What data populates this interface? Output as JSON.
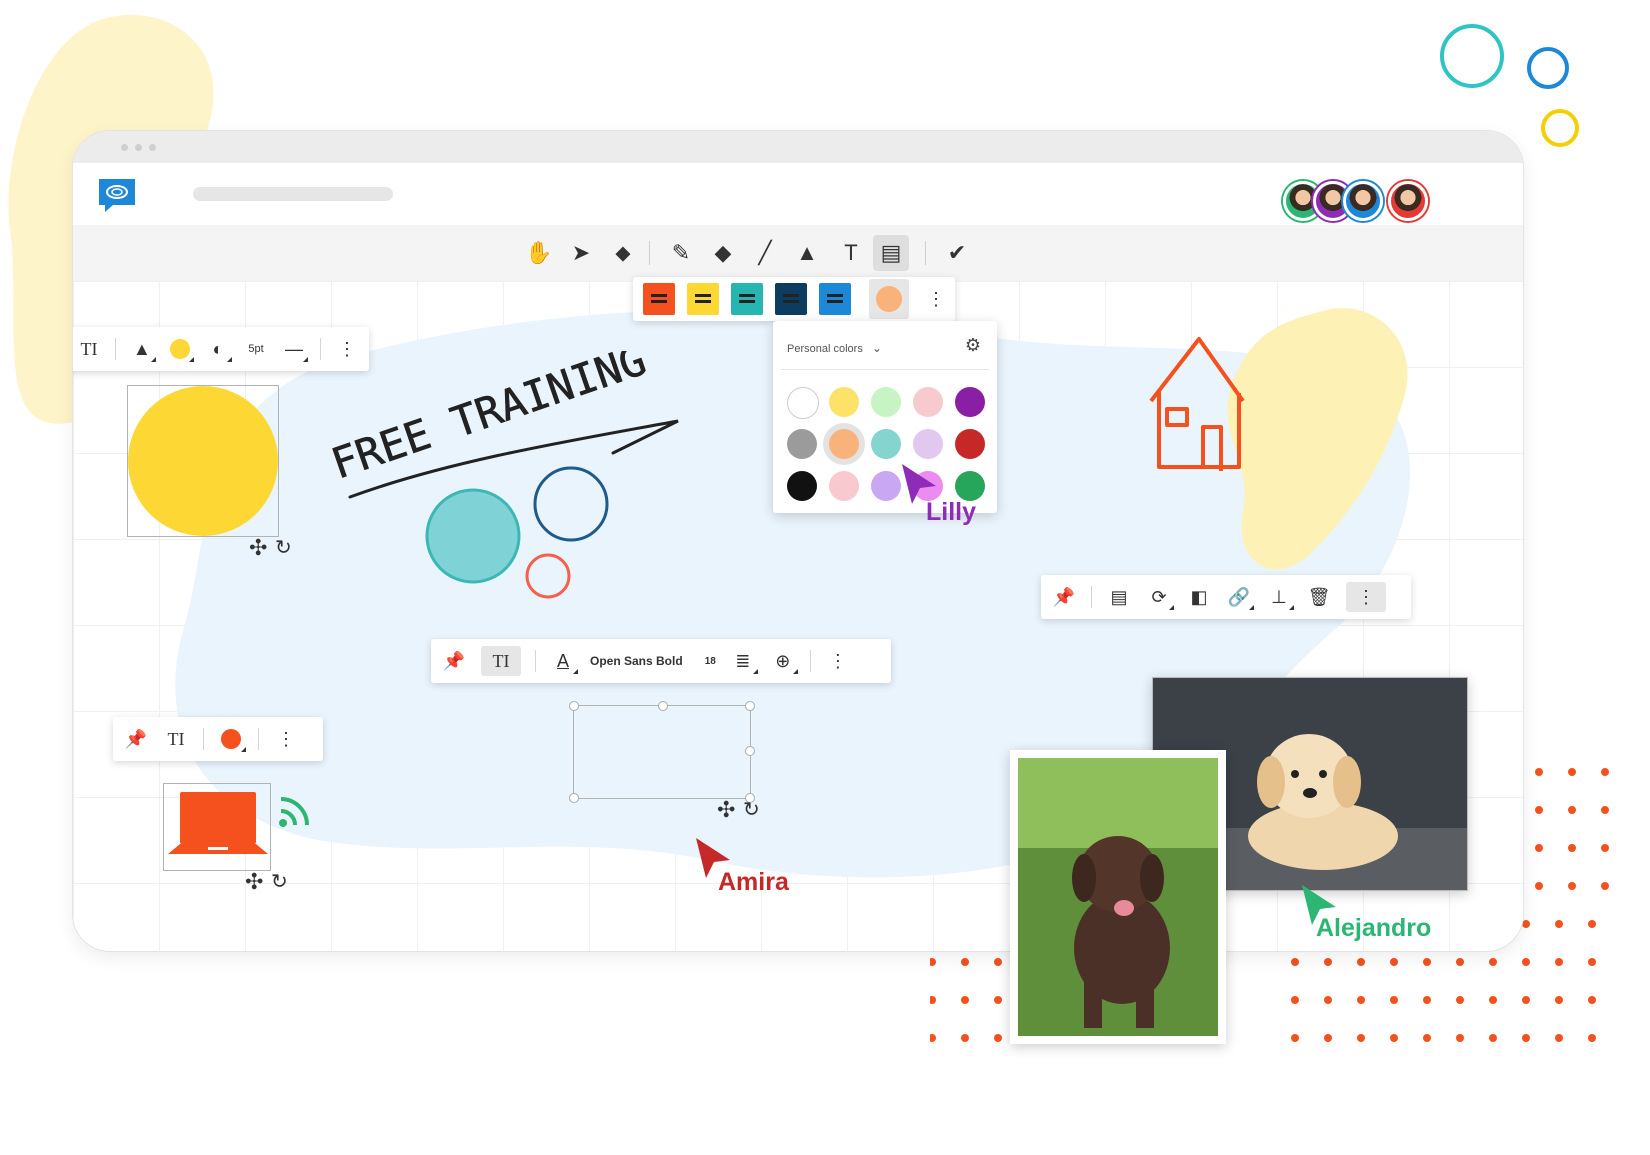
{
  "app": {
    "brand_color": "#1e88d8",
    "logo_icon": "chat-bubble-logo"
  },
  "header": {
    "avatars": [
      {
        "name": "participant-1",
        "ring": "#2bb673"
      },
      {
        "name": "participant-2",
        "ring": "#8e2cb8"
      },
      {
        "name": "participant-3",
        "ring": "#1e88d8"
      },
      {
        "name": "participant-4",
        "ring": "#e53935"
      }
    ]
  },
  "toolbar": {
    "tools": [
      {
        "name": "hand-tool",
        "glyph": "✋"
      },
      {
        "name": "select-tool",
        "glyph": "➤"
      },
      {
        "name": "eraser-tool",
        "glyph": "⬥"
      },
      {
        "name": "pen-tool",
        "glyph": "✎"
      },
      {
        "name": "highlighter-tool",
        "glyph": "◆"
      },
      {
        "name": "line-tool",
        "glyph": "╱"
      },
      {
        "name": "shape-tool",
        "glyph": "▲"
      },
      {
        "name": "text-tool",
        "glyph": "T"
      },
      {
        "name": "sticky-note-tool",
        "glyph": "▤",
        "active": true
      },
      {
        "name": "feedback-tool",
        "glyph": "✔"
      }
    ],
    "sticky_colors": [
      "#f4511e",
      "#fdd835",
      "#26b6b2",
      "#0d3c61",
      "#1e88d8"
    ],
    "custom_color": "#f9b27a"
  },
  "color_picker": {
    "dropdown_label": "Personal colors",
    "swatches": [
      "#ffffff",
      "#fde26a",
      "#c8f3c5",
      "#f8c9cf",
      "#8a1ea5",
      "#9b9b9b",
      "#f9b27a",
      "#86d4cf",
      "#e1c8f0",
      "#c62828",
      "#111111",
      "#f8c9cf",
      "#c9a7f2",
      "#ec8bf0",
      "#26a65b"
    ]
  },
  "board": {
    "handwriting": "FREE TRAINING",
    "shape_toolbar": {
      "stroke_label": "5pt",
      "fill_color": "#fdd835"
    },
    "text_toolbar": {
      "font_name": "Open Sans Bold",
      "font_size": "18"
    },
    "icon_toolbar": {
      "fill_color": "#f4511e"
    },
    "circle_yellow": "#fdd835",
    "circle_teal": "#7fd3d6",
    "circle_navy": "#1d5b8c",
    "circle_orange": "#f4614f",
    "laptop_color": "#f4511e",
    "wifi_color": "#2bb673",
    "house_color": "#f4511e"
  },
  "cursors": [
    {
      "label": "Lilly",
      "color": "#8e2cb8"
    },
    {
      "label": "Amira",
      "color": "#c62828"
    },
    {
      "label": "Alejandro",
      "color": "#2bb673"
    }
  ],
  "images": {
    "puppy_golden": "golden retriever puppy photo",
    "puppy_chocolate": "chocolate labrador puppy photo"
  }
}
